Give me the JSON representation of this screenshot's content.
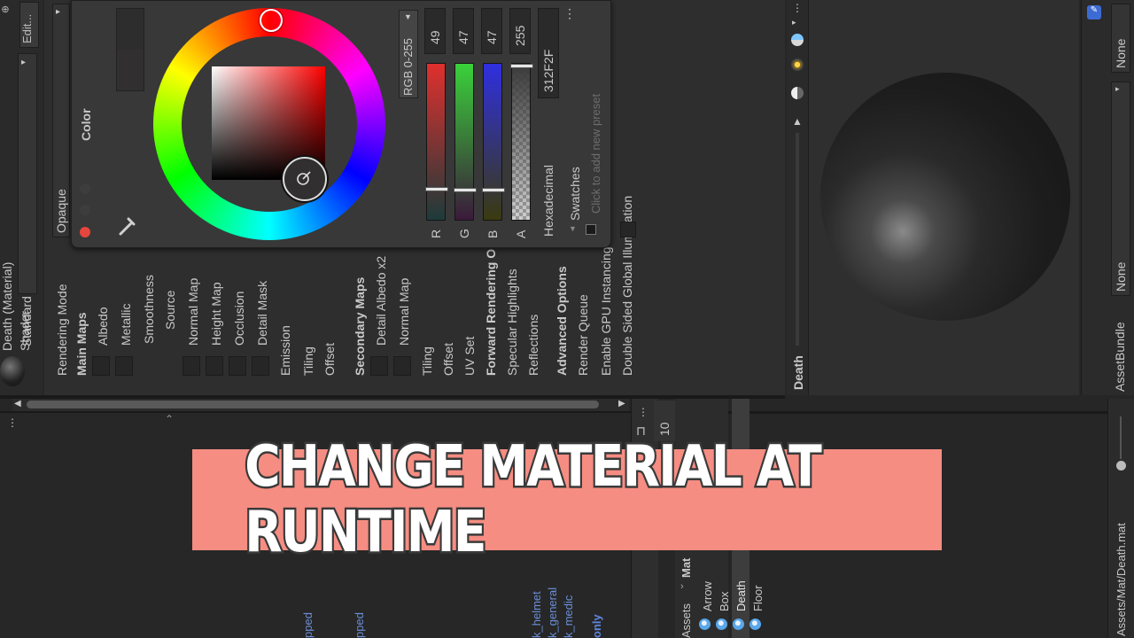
{
  "banner": {
    "title": "CHANGE MATERIAL AT RUNTIME"
  },
  "inspector": {
    "edit_button": "Edit...",
    "material_name": "Death (Material)",
    "shader_label": "Shader",
    "shader_value": "Standard",
    "rendering_mode_value": "Opaque",
    "properties": [
      "Rendering Mode",
      "Main Maps",
      "Albedo",
      "Metallic",
      "Smoothness",
      "Source",
      "Normal Map",
      "Height Map",
      "Occlusion",
      "Detail Mask",
      "Emission",
      "Tiling",
      "Offset",
      "Secondary Maps",
      "Detail Albedo x2",
      "Normal Map",
      "Tiling",
      "Offset",
      "UV Set",
      "Forward Rendering Options",
      "Specular Highlights",
      "Reflections",
      "Advanced Options",
      "Render Queue",
      "Enable GPU Instancing",
      "Double Sided Global Illumination"
    ]
  },
  "color_picker": {
    "color_label": "Color",
    "mode": "RGB 0-255",
    "channels": [
      {
        "label": "R",
        "value": "49"
      },
      {
        "label": "G",
        "value": "47"
      },
      {
        "label": "B",
        "value": "47"
      },
      {
        "label": "A",
        "value": "255"
      }
    ],
    "hex_label": "Hexadecimal",
    "hex_value": "312F2F",
    "swatches_label": "Swatches",
    "swatches_hint": "Click to add new preset",
    "current_color": "#312F2F",
    "channel_fractions": {
      "r": 0.192,
      "g": 0.184,
      "b": 0.184,
      "a": 1.0
    }
  },
  "preview": {
    "label": "Death",
    "none_top": "None",
    "none_bottom": "None",
    "asset_bundle": "AssetBundle"
  },
  "project": {
    "count": "10",
    "breadcrumb_root": "Assets",
    "breadcrumb_folder": "Mat",
    "assets": [
      "Arrow",
      "Box",
      "Death",
      "Floor"
    ],
    "path": "Assets/Mat/Death.mat",
    "blue_items": [
      "k_helmet",
      "k_general",
      "k_medic",
      "only",
      "pped",
      "pped"
    ]
  },
  "colors": {
    "accent": "#f68d82",
    "selection": "#6b8fd8"
  }
}
